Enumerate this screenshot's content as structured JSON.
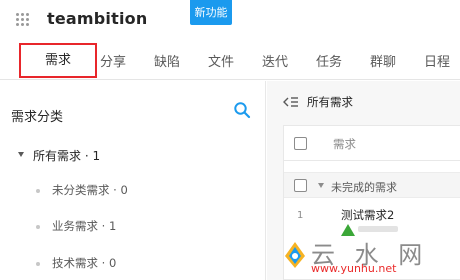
{
  "header": {
    "logo_text": "teambition",
    "new_feature_badge": "新功能"
  },
  "tabs": [
    {
      "label": "需求",
      "active": true
    },
    {
      "label": "分享"
    },
    {
      "label": "缺陷"
    },
    {
      "label": "文件"
    },
    {
      "label": "迭代"
    },
    {
      "label": "任务"
    },
    {
      "label": "群聊"
    },
    {
      "label": "日程"
    }
  ],
  "sidebar": {
    "title": "需求分类",
    "search_icon": "search-icon",
    "root": {
      "label": "所有需求 · 1"
    },
    "items": [
      {
        "label": "未分类需求 · 0"
      },
      {
        "label": "业务需求 · 1"
      },
      {
        "label": "技术需求 · 0"
      }
    ]
  },
  "main": {
    "title": "所有需求",
    "column_header": "需求",
    "group_label": "未完成的需求",
    "rows": [
      {
        "index": "1",
        "name": "测试需求2"
      }
    ]
  },
  "watermark": {
    "text": "云 水 网",
    "url": "www.yunhu.net"
  },
  "colors": {
    "accent": "#1b9aee",
    "highlight_box": "#e8262b",
    "task_icon": "#3ba738"
  }
}
